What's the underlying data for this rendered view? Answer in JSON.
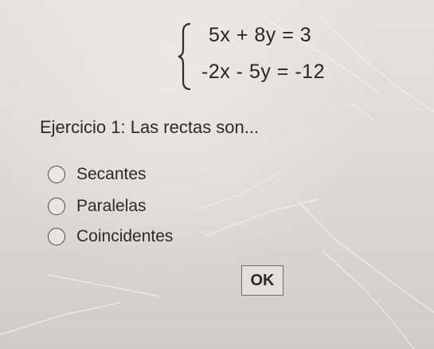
{
  "system": {
    "equation_1": "5x + 8y = 3",
    "equation_2": "-2x - 5y = -12"
  },
  "question": "Ejercicio 1: Las rectas son...",
  "options": [
    {
      "label": "Secantes",
      "selected": false
    },
    {
      "label": "Paralelas",
      "selected": false
    },
    {
      "label": "Coincidentes",
      "selected": false
    }
  ],
  "ok_label": "OK",
  "icons": {
    "brace": "left-curly-brace",
    "radio": "radio-circle"
  }
}
